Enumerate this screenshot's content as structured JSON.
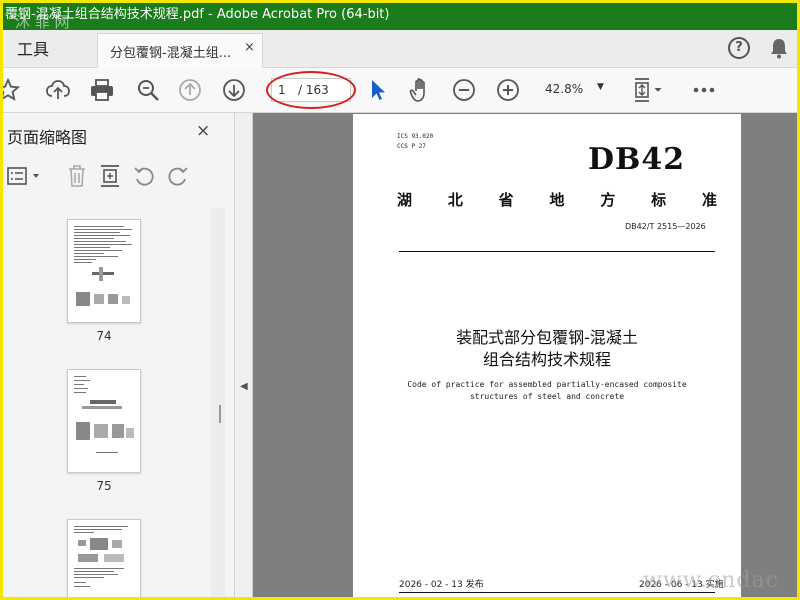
{
  "window": {
    "title": "覆钢-混凝土组合结构技术规程.pdf - Adobe Acrobat Pro (64-bit)",
    "watermark_top": "沐 菲 网",
    "watermark_bottom": "www.cndac"
  },
  "tabs": {
    "tools_label": "工具",
    "document_label": "分包覆钢-混凝土组...",
    "close_glyph": "×"
  },
  "toolbar": {
    "page_current": "1",
    "page_total": "/ 163",
    "zoom": "42.8%",
    "icons": [
      "star-icon",
      "cloud-upload-icon",
      "print-icon",
      "zoom-search-icon",
      "page-up-icon",
      "page-down-icon",
      "select-pointer-icon",
      "hand-tool-icon",
      "zoom-out-icon",
      "zoom-in-icon",
      "page-fit-icon",
      "more-icon"
    ],
    "highlight_color": "#d81f1f"
  },
  "sidebar": {
    "title": "页面缩略图",
    "close_glyph": "×",
    "thumbnails": [
      {
        "label": "74"
      },
      {
        "label": "75"
      },
      {
        "label": ""
      }
    ]
  },
  "document": {
    "ics_line1": "ICS  93.020",
    "ics_line2": "CCS  P 27",
    "standard_prefix": "DB42",
    "province_chars": [
      "湖",
      "北",
      "省",
      "地",
      "方",
      "标",
      "准"
    ],
    "code": "DB42/T 2515—2026",
    "title_line1": "装配式部分包覆钢-混凝土",
    "title_line2": "组合结构技术规程",
    "english_line1": "Code of practice for assembled partially-encased composite",
    "english_line2": "structures of steel and concrete",
    "issue_date": "2026 - 02 - 13 发布",
    "impl_date": "2026 - 06 - 13 实施"
  },
  "colors": {
    "titlebar": "#1b7c1b",
    "frame": "#f3e600",
    "viewer_bg": "#7f7f7f",
    "select_arrow": "#1a5fc8"
  }
}
